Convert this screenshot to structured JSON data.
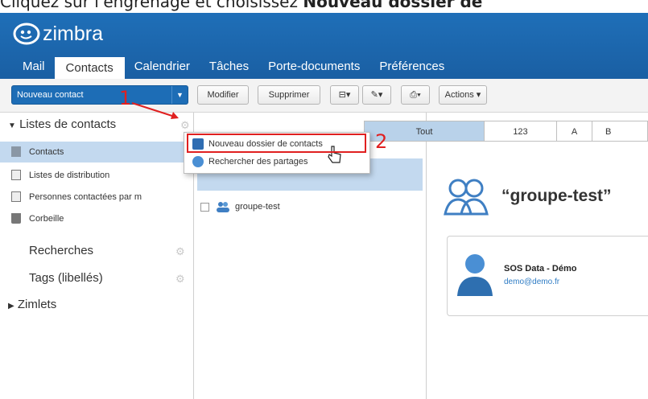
{
  "caption": {
    "prefix": "Cliquez sur l'engrenage et choisissez ",
    "bold": "Nouveau dossier de"
  },
  "app": {
    "logo_text": "zimbra"
  },
  "tabs": [
    {
      "label": "Mail"
    },
    {
      "label": "Contacts"
    },
    {
      "label": "Calendrier"
    },
    {
      "label": "Tâches"
    },
    {
      "label": "Porte-documents"
    },
    {
      "label": "Préférences"
    }
  ],
  "toolbar": {
    "new_contact": "Nouveau contact",
    "edit": "Modifier",
    "delete": "Supprimer",
    "actions": "Actions ▾"
  },
  "sidebar": {
    "contact_lists_heading": "Listes de contacts",
    "items": [
      {
        "label": "Contacts"
      },
      {
        "label": "Listes de distribution"
      },
      {
        "label": "Personnes contactées par m"
      },
      {
        "label": "Corbeille"
      }
    ],
    "searches": "Recherches",
    "tags": "Tags (libellés)",
    "zimlets": "Zimlets"
  },
  "alpha_filter": [
    "Tout",
    "123",
    "A",
    "B"
  ],
  "context_menu": {
    "new_folder": "Nouveau dossier de contacts",
    "search_shares": "Rechercher des partages"
  },
  "list": {
    "rows": [
      {
        "label": "groupe-test"
      }
    ]
  },
  "detail": {
    "group_name": "“groupe-test”",
    "member_name": "SOS Data - Démo",
    "member_email": "demo@demo.fr"
  },
  "annotations": {
    "step1": "1",
    "step2": "2"
  },
  "colors": {
    "brand": "#1f6fb8",
    "highlight": "#e02020",
    "selection": "#c3d9ef"
  }
}
